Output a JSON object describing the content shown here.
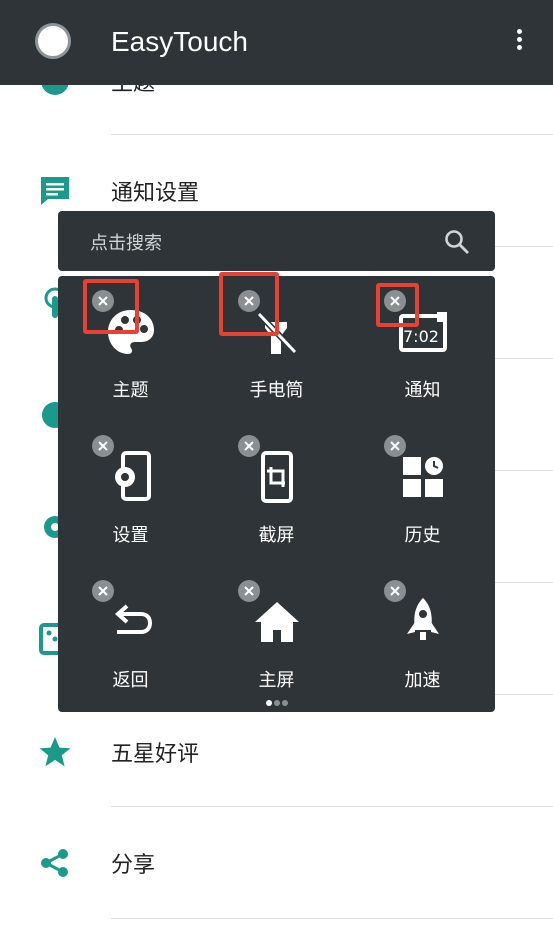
{
  "app_bar": {
    "title": "EasyTouch"
  },
  "menu": {
    "items": [
      {
        "label": "主题",
        "icon": "palette-icon"
      },
      {
        "label": "通知设置",
        "icon": "message-icon"
      },
      {
        "label": "",
        "icon": "touch-icon"
      },
      {
        "label": "",
        "icon": "toggle-icon"
      },
      {
        "label": "",
        "icon": "settings-icon"
      },
      {
        "label": "",
        "icon": "dice-icon"
      },
      {
        "label": "五星好评",
        "icon": "star-icon"
      },
      {
        "label": "分享",
        "icon": "share-icon"
      }
    ]
  },
  "popup": {
    "search_placeholder": "点击搜索",
    "tiles": [
      {
        "label": "主题",
        "icon": "palette-icon"
      },
      {
        "label": "手电筒",
        "icon": "flashlight-off-icon"
      },
      {
        "label": "通知",
        "icon": "notification-clock-icon",
        "icon_text": "7:02"
      },
      {
        "label": "设置",
        "icon": "phone-settings-icon"
      },
      {
        "label": "截屏",
        "icon": "phone-crop-icon"
      },
      {
        "label": "历史",
        "icon": "recent-apps-icon"
      },
      {
        "label": "返回",
        "icon": "back-arrow-icon"
      },
      {
        "label": "主屏",
        "icon": "home-icon"
      },
      {
        "label": "加速",
        "icon": "rocket-icon"
      }
    ],
    "page_indicator": {
      "current": 1,
      "total": 3
    },
    "highlighted_remove_buttons": [
      "主题",
      "手电筒",
      "通知"
    ]
  },
  "colors": {
    "app_bar": "#2e3437",
    "accent": "#1a9a8a",
    "panel": "#2e3437",
    "highlight": "#e84033"
  }
}
